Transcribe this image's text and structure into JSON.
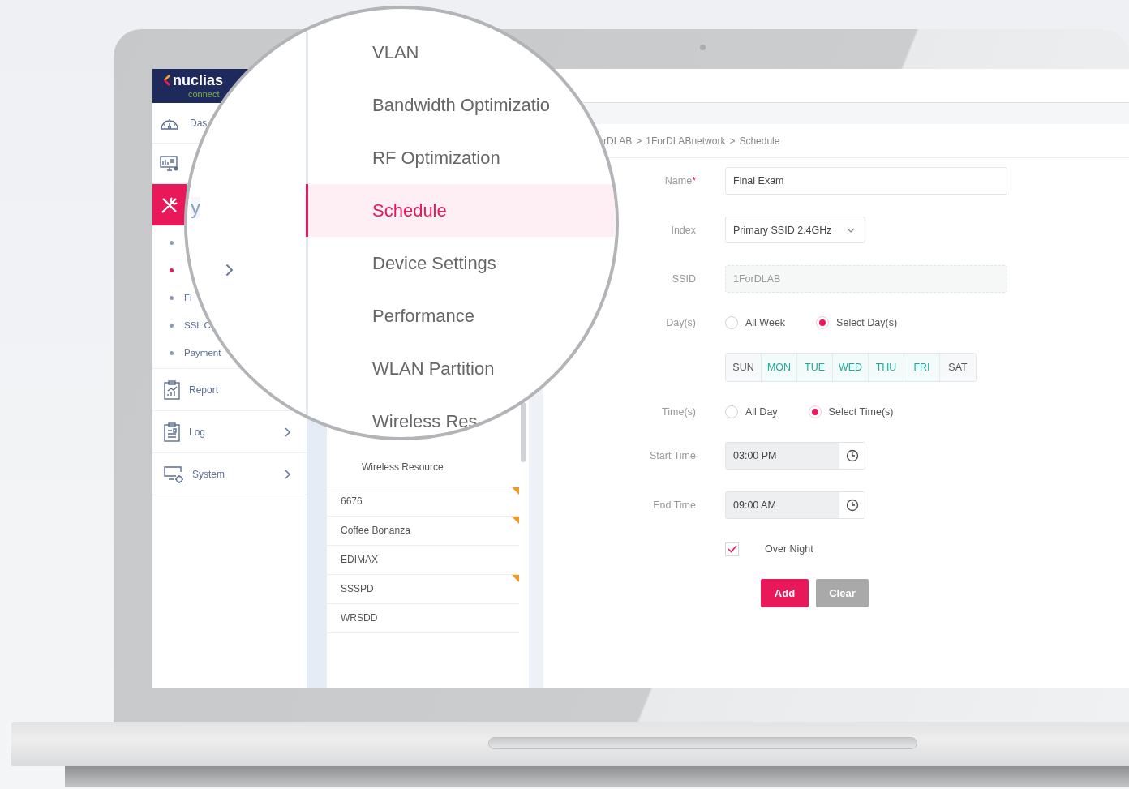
{
  "logo": {
    "brand": "nuclias",
    "sub": "connect"
  },
  "sidebar": {
    "items": [
      {
        "kind": "dashboard",
        "label": "Das",
        "selected": false
      },
      {
        "kind": "monitor",
        "selected": false
      },
      {
        "kind": "tools",
        "selected": true
      }
    ],
    "sub_items": [
      {
        "selected": false
      },
      {
        "selected": true
      },
      {
        "label": "Fi",
        "selected": false
      },
      {
        "label": "SSL C",
        "selected": false
      },
      {
        "label": "Payment",
        "selected": false
      }
    ],
    "bottom_items": [
      {
        "kind": "report",
        "label": "Report",
        "chevron": false
      },
      {
        "kind": "log",
        "label": "Log",
        "chevron": true
      },
      {
        "kind": "system",
        "label": "System",
        "chevron": true
      }
    ]
  },
  "magnifier": {
    "fragment": "y",
    "items": [
      {
        "label": "VLAN",
        "selected": false
      },
      {
        "label": "Bandwidth Optimizatio",
        "selected": false
      },
      {
        "label": "RF Optimization",
        "selected": false
      },
      {
        "label": "Schedule",
        "selected": true
      },
      {
        "label": "Device Settings",
        "selected": false
      },
      {
        "label": "Performance",
        "selected": false
      },
      {
        "label": "WLAN Partition",
        "selected": false
      },
      {
        "label": "Wireless Res",
        "selected": false
      }
    ]
  },
  "submenu": {
    "items": [
      {
        "label": "Wireless Resource"
      }
    ]
  },
  "sites": [
    {
      "label": "6676",
      "flagged": true
    },
    {
      "label": "Coffee Bonanza",
      "flagged": true
    },
    {
      "label": "EDIMAX",
      "flagged": false
    },
    {
      "label": "SSSPD",
      "flagged": true
    },
    {
      "label": "WRSDD",
      "flagged": false
    }
  ],
  "breadcrumb": {
    "separator": ">",
    "items": [
      "rDLAB",
      "1ForDLABnetwork",
      "Schedule"
    ]
  },
  "form": {
    "name": {
      "label": "Name",
      "required_mark": "*",
      "value": "Final Exam"
    },
    "index": {
      "label": "Index",
      "value": "Primary SSID 2.4GHz"
    },
    "ssid": {
      "label": "SSID",
      "value": "1ForDLAB",
      "disabled": true
    },
    "days": {
      "label": "Day(s)",
      "options": [
        {
          "label": "All Week",
          "selected": false
        },
        {
          "label": "Select Day(s)",
          "selected": true
        }
      ],
      "day_buttons": [
        {
          "label": "SUN",
          "selected": false
        },
        {
          "label": "MON",
          "selected": true
        },
        {
          "label": "TUE",
          "selected": true
        },
        {
          "label": "WED",
          "selected": true
        },
        {
          "label": "THU",
          "selected": true
        },
        {
          "label": "FRI",
          "selected": true
        },
        {
          "label": "SAT",
          "selected": false
        }
      ]
    },
    "times": {
      "label": "Time(s)",
      "options": [
        {
          "label": "All Day",
          "selected": false
        },
        {
          "label": "Select Time(s)",
          "selected": true
        }
      ]
    },
    "start_time": {
      "label": "Start Time",
      "value": "03:00 PM"
    },
    "end_time": {
      "label": "End Time",
      "value": "09:00 AM"
    },
    "over_night": {
      "label": "Over Night",
      "checked": true
    },
    "buttons": [
      {
        "label": "Add",
        "kind": "primary"
      },
      {
        "label": "Clear",
        "kind": "secondary"
      }
    ]
  }
}
